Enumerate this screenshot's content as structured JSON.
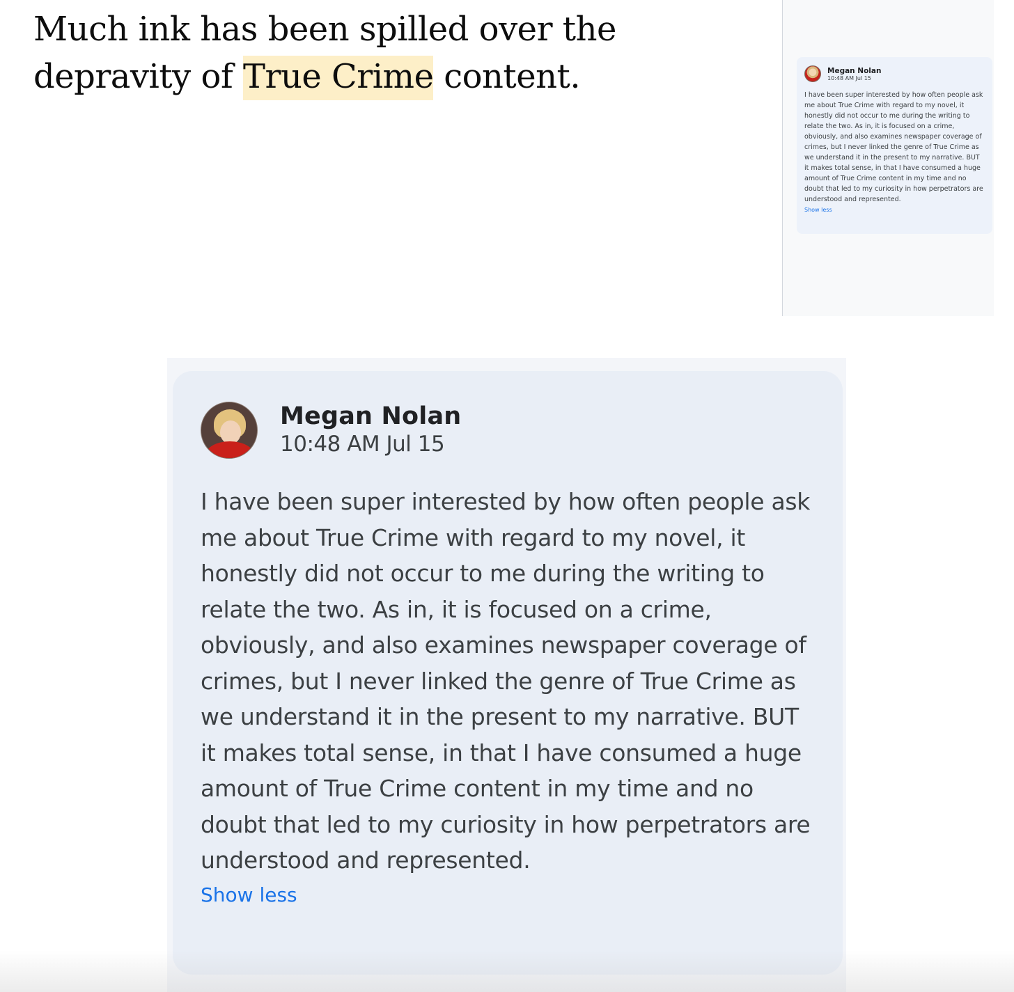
{
  "document": {
    "text_before": "Much ink has been spilled over the depravity of ",
    "highlight": "True Crime",
    "text_after": " content."
  },
  "comment": {
    "author": "Megan Nolan",
    "timestamp": "10:48 AM Jul 15",
    "body": "I have been super interested by how often people ask me about True Crime with regard to my novel, it honestly did not occur to me during the writing to relate the two. As in, it is focused on a crime, obviously, and also examines newspaper coverage of crimes, but I never linked the genre of True Crime as we understand it in the present to my narrative. BUT it makes total sense, in that I have consumed a huge amount of True Crime content in my time and no doubt that led to my curiosity in how perpetrators are understood and represented.",
    "show_less_label": "Show less"
  },
  "colors": {
    "highlight": "#fdefc8",
    "comment_card": "#e9eef6",
    "link": "#1a73e8",
    "text": "#3c4043"
  },
  "icons": {
    "avatar": "user-photo-avatar"
  }
}
